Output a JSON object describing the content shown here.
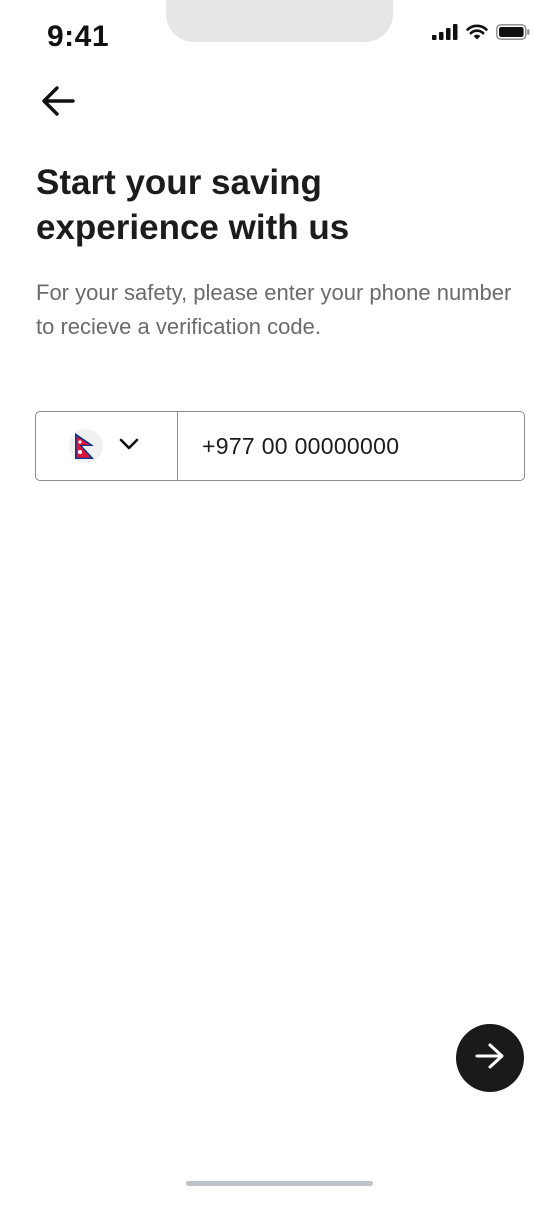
{
  "status_bar": {
    "time": "9:41",
    "icons": [
      "cellular-signal-icon",
      "wifi-icon",
      "battery-icon"
    ]
  },
  "header": {
    "back_icon": "arrow-left-icon"
  },
  "main": {
    "title": "Start your saving experience with us",
    "subtitle": "For your safety, please enter your phone number to recieve a verification code."
  },
  "phone_field": {
    "country_flag": "nepal-flag-icon",
    "dropdown_icon": "chevron-down-icon",
    "value": "+977 00 00000000"
  },
  "footer": {
    "next_icon": "arrow-right-icon"
  },
  "colors": {
    "primary_dark": "#1a1a1a",
    "text_secondary": "#6b6b6b",
    "border": "#8d8d8d",
    "flag_red": "#dc143c",
    "flag_blue": "#003893"
  }
}
